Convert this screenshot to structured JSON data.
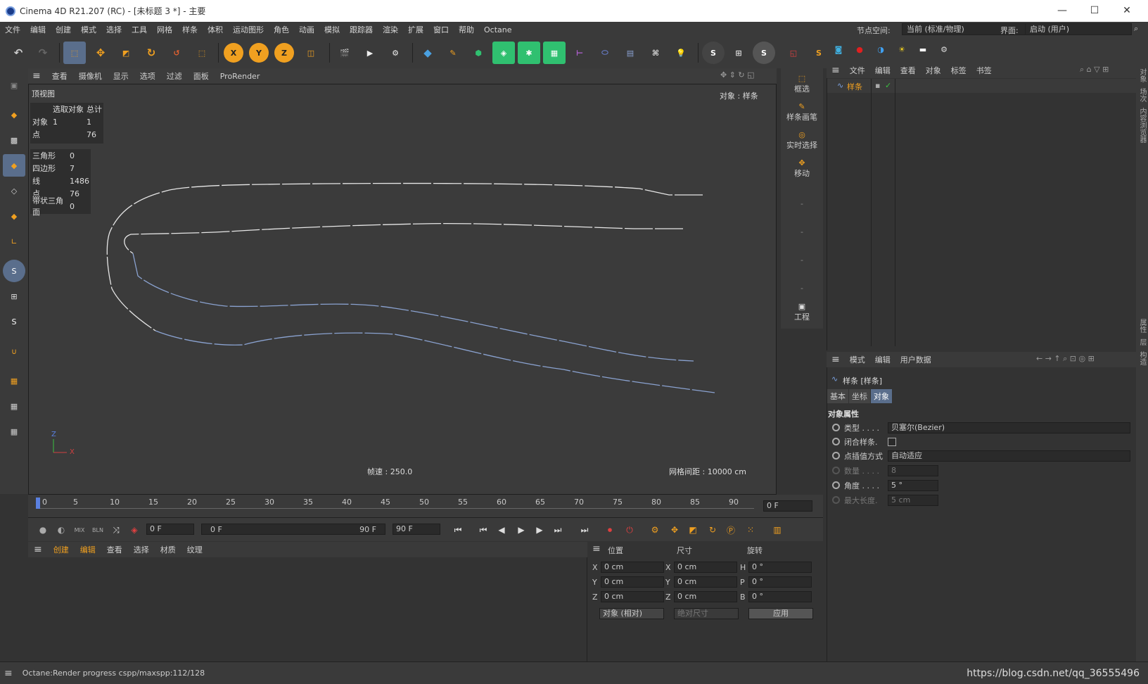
{
  "window": {
    "title": "Cinema 4D R21.207 (RC) - [未标题 3 *] - 主要",
    "minimize": "—",
    "maximize": "☐",
    "close": "✕"
  },
  "menu": [
    "文件",
    "编辑",
    "创建",
    "模式",
    "选择",
    "工具",
    "网格",
    "样条",
    "体积",
    "运动图形",
    "角色",
    "动画",
    "模拟",
    "跟踪器",
    "渲染",
    "扩展",
    "窗口",
    "帮助",
    "Octane"
  ],
  "nodespace": {
    "label": "节点空间:",
    "value": "当前 (标准/物理)"
  },
  "layout": {
    "label": "界面:",
    "value": "启动 (用户)"
  },
  "viewport": {
    "menu": [
      "查看",
      "摄像机",
      "显示",
      "选项",
      "过滤",
      "面板",
      "ProRender"
    ],
    "name": "顶视图",
    "object_label": "对象 : 样条",
    "speed": "帧速 : 250.0",
    "grid": "网格间距 : 10000 cm",
    "axis_z": "Z",
    "axis_x": "X",
    "stats1": {
      "h1": "选取对象",
      "h2": "总计",
      "rows": [
        {
          "k": "对象",
          "a": "1",
          "b": "1"
        },
        {
          "k": "点",
          "a": "",
          "b": "76"
        }
      ]
    },
    "stats2": {
      "rows": [
        {
          "k": "三角形",
          "v": "0"
        },
        {
          "k": "四边形",
          "v": "7"
        },
        {
          "k": "线",
          "v": "1486"
        },
        {
          "k": "点",
          "v": "76"
        },
        {
          "k": "带状三角面",
          "v": "0"
        }
      ]
    }
  },
  "right_tools": [
    {
      "label": "框选"
    },
    {
      "label": "样条画笔"
    },
    {
      "label": "实时选择"
    },
    {
      "label": "移动"
    },
    {
      "label": "-"
    },
    {
      "label": "-"
    },
    {
      "label": "-"
    },
    {
      "label": "-"
    },
    {
      "label": "工程"
    }
  ],
  "objects": {
    "menu": [
      "文件",
      "编辑",
      "查看",
      "对象",
      "标签",
      "书签"
    ],
    "items": [
      {
        "name": "样条"
      }
    ]
  },
  "attributes": {
    "menu": [
      "模式",
      "编辑",
      "用户数据"
    ],
    "object": "样条 [样条]",
    "tabs": [
      "基本",
      "坐标",
      "对象"
    ],
    "active_tab": "对象",
    "section": "对象属性",
    "props": [
      {
        "label": "类型 . . . .",
        "value": "贝塞尔(Bezier)"
      },
      {
        "label": "闭合样条.",
        "value": ""
      },
      {
        "label": "点插值方式",
        "value": "自动适应"
      },
      {
        "label": "数量 . . . .",
        "value": "8"
      },
      {
        "label": "角度 . . . .",
        "value": "5 °"
      },
      {
        "label": "最大长度.",
        "value": "5 cm"
      }
    ]
  },
  "side_tabs": [
    "对象",
    "场次",
    "内容浏览器",
    "属性",
    "层",
    "构造"
  ],
  "timeline": {
    "ticks": [
      "0",
      "5",
      "10",
      "15",
      "20",
      "25",
      "30",
      "35",
      "40",
      "45",
      "50",
      "55",
      "60",
      "65",
      "70",
      "75",
      "80",
      "85",
      "90"
    ],
    "frame": "0 F"
  },
  "transport": {
    "start": "0 F",
    "min": "0 F",
    "max": "90 F",
    "end": "90 F"
  },
  "materials": {
    "menu": [
      "创建",
      "编辑",
      "查看",
      "选择",
      "材质",
      "纹理"
    ]
  },
  "coords": {
    "headers": [
      "位置",
      "尺寸",
      "旋转"
    ],
    "rows": [
      {
        "a": "X",
        "av": "0 cm",
        "b": "X",
        "bv": "0 cm",
        "c": "H",
        "cv": "0 °"
      },
      {
        "a": "Y",
        "av": "0 cm",
        "b": "Y",
        "bv": "0 cm",
        "c": "P",
        "cv": "0 °"
      },
      {
        "a": "Z",
        "av": "0 cm",
        "b": "Z",
        "bv": "0 cm",
        "c": "B",
        "cv": "0 °"
      }
    ],
    "mode": "对象 (相对)",
    "size_mode": "绝对尺寸",
    "apply": "应用"
  },
  "status": "Octane:Render progress  cspp/maxspp:112/128",
  "watermark": "https://blog.csdn.net/qq_36555496"
}
